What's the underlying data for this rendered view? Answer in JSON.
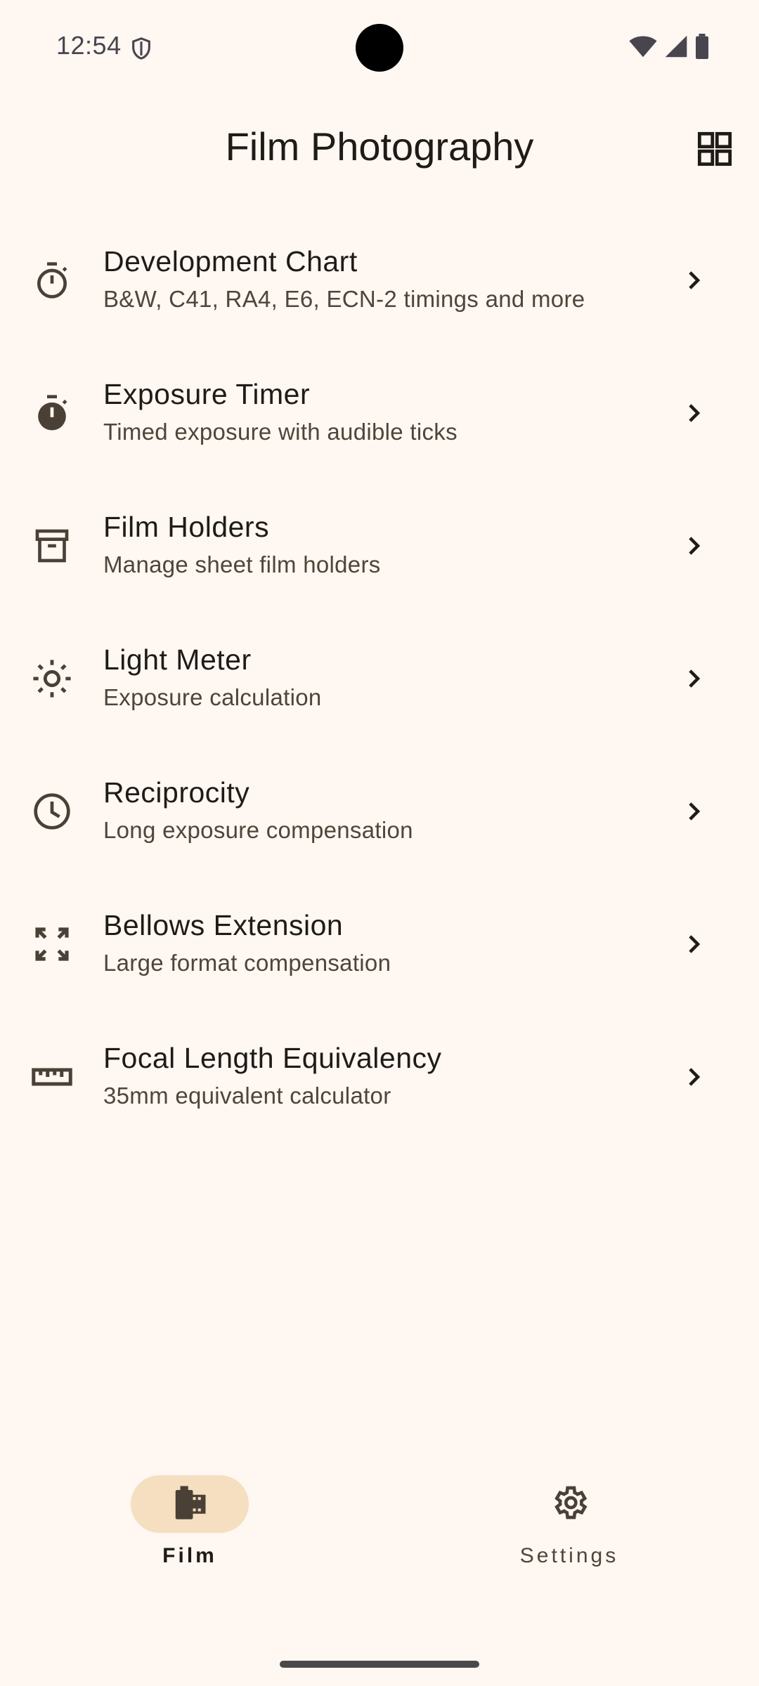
{
  "status_bar": {
    "time": "12:54",
    "icons": [
      "shield-icon",
      "wifi-icon",
      "signal-icon",
      "battery-icon"
    ]
  },
  "app_bar": {
    "title": "Film Photography",
    "action_icon": "grid-view-icon"
  },
  "menu": {
    "items": [
      {
        "title": "Development Chart",
        "subtitle": "B&W, C41, RA4, E6, ECN-2 timings and more",
        "icon": "stopwatch-outline-icon"
      },
      {
        "title": "Exposure Timer",
        "subtitle": "Timed exposure with audible ticks",
        "icon": "stopwatch-filled-icon"
      },
      {
        "title": "Film Holders",
        "subtitle": "Manage sheet film holders",
        "icon": "archive-box-icon"
      },
      {
        "title": "Light Meter",
        "subtitle": "Exposure calculation",
        "icon": "sun-icon"
      },
      {
        "title": "Reciprocity",
        "subtitle": "Long exposure compensation",
        "icon": "clock-icon"
      },
      {
        "title": "Bellows Extension",
        "subtitle": "Large format compensation",
        "icon": "expand-arrows-icon"
      },
      {
        "title": "Focal Length Equivalency",
        "subtitle": "35mm equivalent calculator",
        "icon": "ruler-icon"
      }
    ]
  },
  "bottom_nav": {
    "film_label": "Film",
    "settings_label": "Settings",
    "selected": "Film"
  },
  "colors": {
    "background": "#FEF7F2",
    "icon": "#4A4036",
    "active_pill": "#F5DFC0",
    "text": "#1F1B16"
  }
}
